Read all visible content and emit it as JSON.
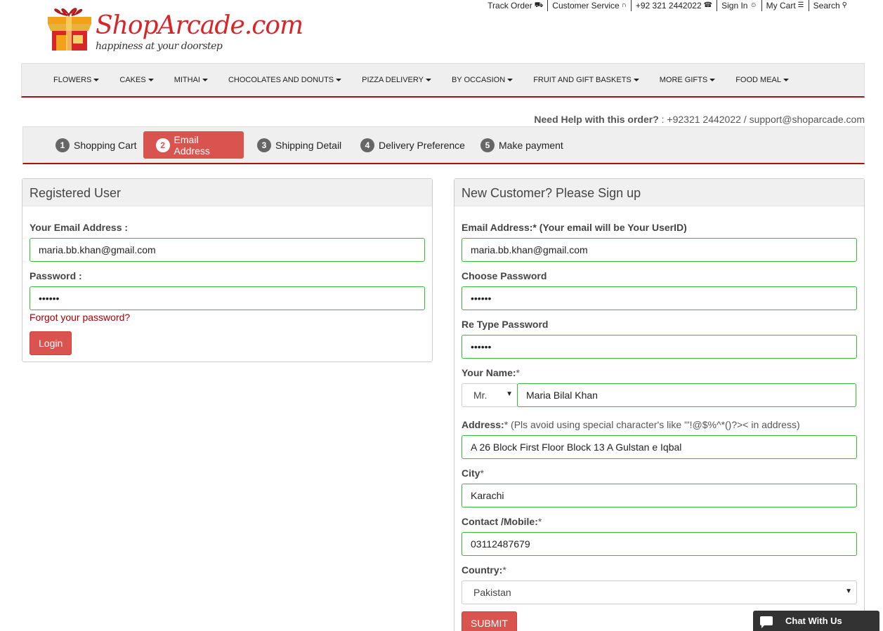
{
  "topbar": {
    "links": [
      {
        "label": "Track Order",
        "icon": "truck-icon",
        "glyph": "⛟"
      },
      {
        "label": "Customer Service",
        "icon": "headset-icon",
        "glyph": "∩"
      },
      {
        "label": "+92 321 2442022",
        "icon": "phone-icon",
        "glyph": "☎"
      },
      {
        "label": "Sign In",
        "icon": "user-icon",
        "glyph": "☺"
      },
      {
        "label": "My Cart",
        "icon": "cart-icon",
        "glyph": "☰"
      },
      {
        "label": "Search",
        "icon": "search-icon",
        "glyph": "⚲"
      }
    ]
  },
  "logo": {
    "brand": "ShopArcade.com",
    "tagline": "happiness at your doorstep"
  },
  "nav": {
    "items": [
      "FLOWERS",
      "CAKES",
      "MITHAI",
      "CHOCOLATES AND DONUTS",
      "PIZZA DELIVERY",
      "BY OCCASION",
      "FRUIT AND GIFT BASKETS",
      "MORE GIFTS",
      "FOOD MEAL"
    ]
  },
  "help": {
    "label": "Need Help with this order?",
    "contact": " : +92321 2442022 / support@shoparcade.com"
  },
  "steps": [
    {
      "num": "1",
      "label": "Shopping Cart"
    },
    {
      "num": "2",
      "label": "Email Address"
    },
    {
      "num": "3",
      "label": "Shipping Detail"
    },
    {
      "num": "4",
      "label": "Delivery Preference"
    },
    {
      "num": "5",
      "label": "Make payment"
    }
  ],
  "registered": {
    "title": "Registered User",
    "email_label": "Your Email Address :",
    "email_value": "maria.bb.khan@gmail.com",
    "password_label": "Password :",
    "password_value": "••••••",
    "forgot": "Forgot your password?",
    "login": "Login"
  },
  "signup": {
    "title": "New Customer? Please Sign up",
    "email_label": "Email Address:* (Your email will be Your UserID)",
    "email_value": "maria.bb.khan@gmail.com",
    "choose_password_label": "Choose Password",
    "choose_password_value": "••••••",
    "retype_label": "Re Type Password",
    "retype_value": "••••••",
    "name_label": "Your Name:",
    "name_req": "*",
    "title_value": "Mr.",
    "name_value": "Maria Bilal Khan",
    "address_label": "Address:",
    "address_note": "* (Pls avoid using special character's like '\"!@$%^*()?>< in address)",
    "address_value": "A 26 Block First Floor Block 13 A Gulstan e Iqbal",
    "city_label": "City",
    "city_req": "*",
    "city_value": "Karachi",
    "contact_label": "Contact /Mobile:",
    "contact_req": "*",
    "contact_value": "03112487679",
    "country_label": "Country:",
    "country_req": "*",
    "country_value": "Pakistan",
    "submit": "SUBMIT"
  },
  "chat": {
    "label": "Chat With Us"
  },
  "colors": {
    "accent": "#d9534f",
    "nav_border": "#a91212",
    "input_border": "#2fbf2f"
  }
}
